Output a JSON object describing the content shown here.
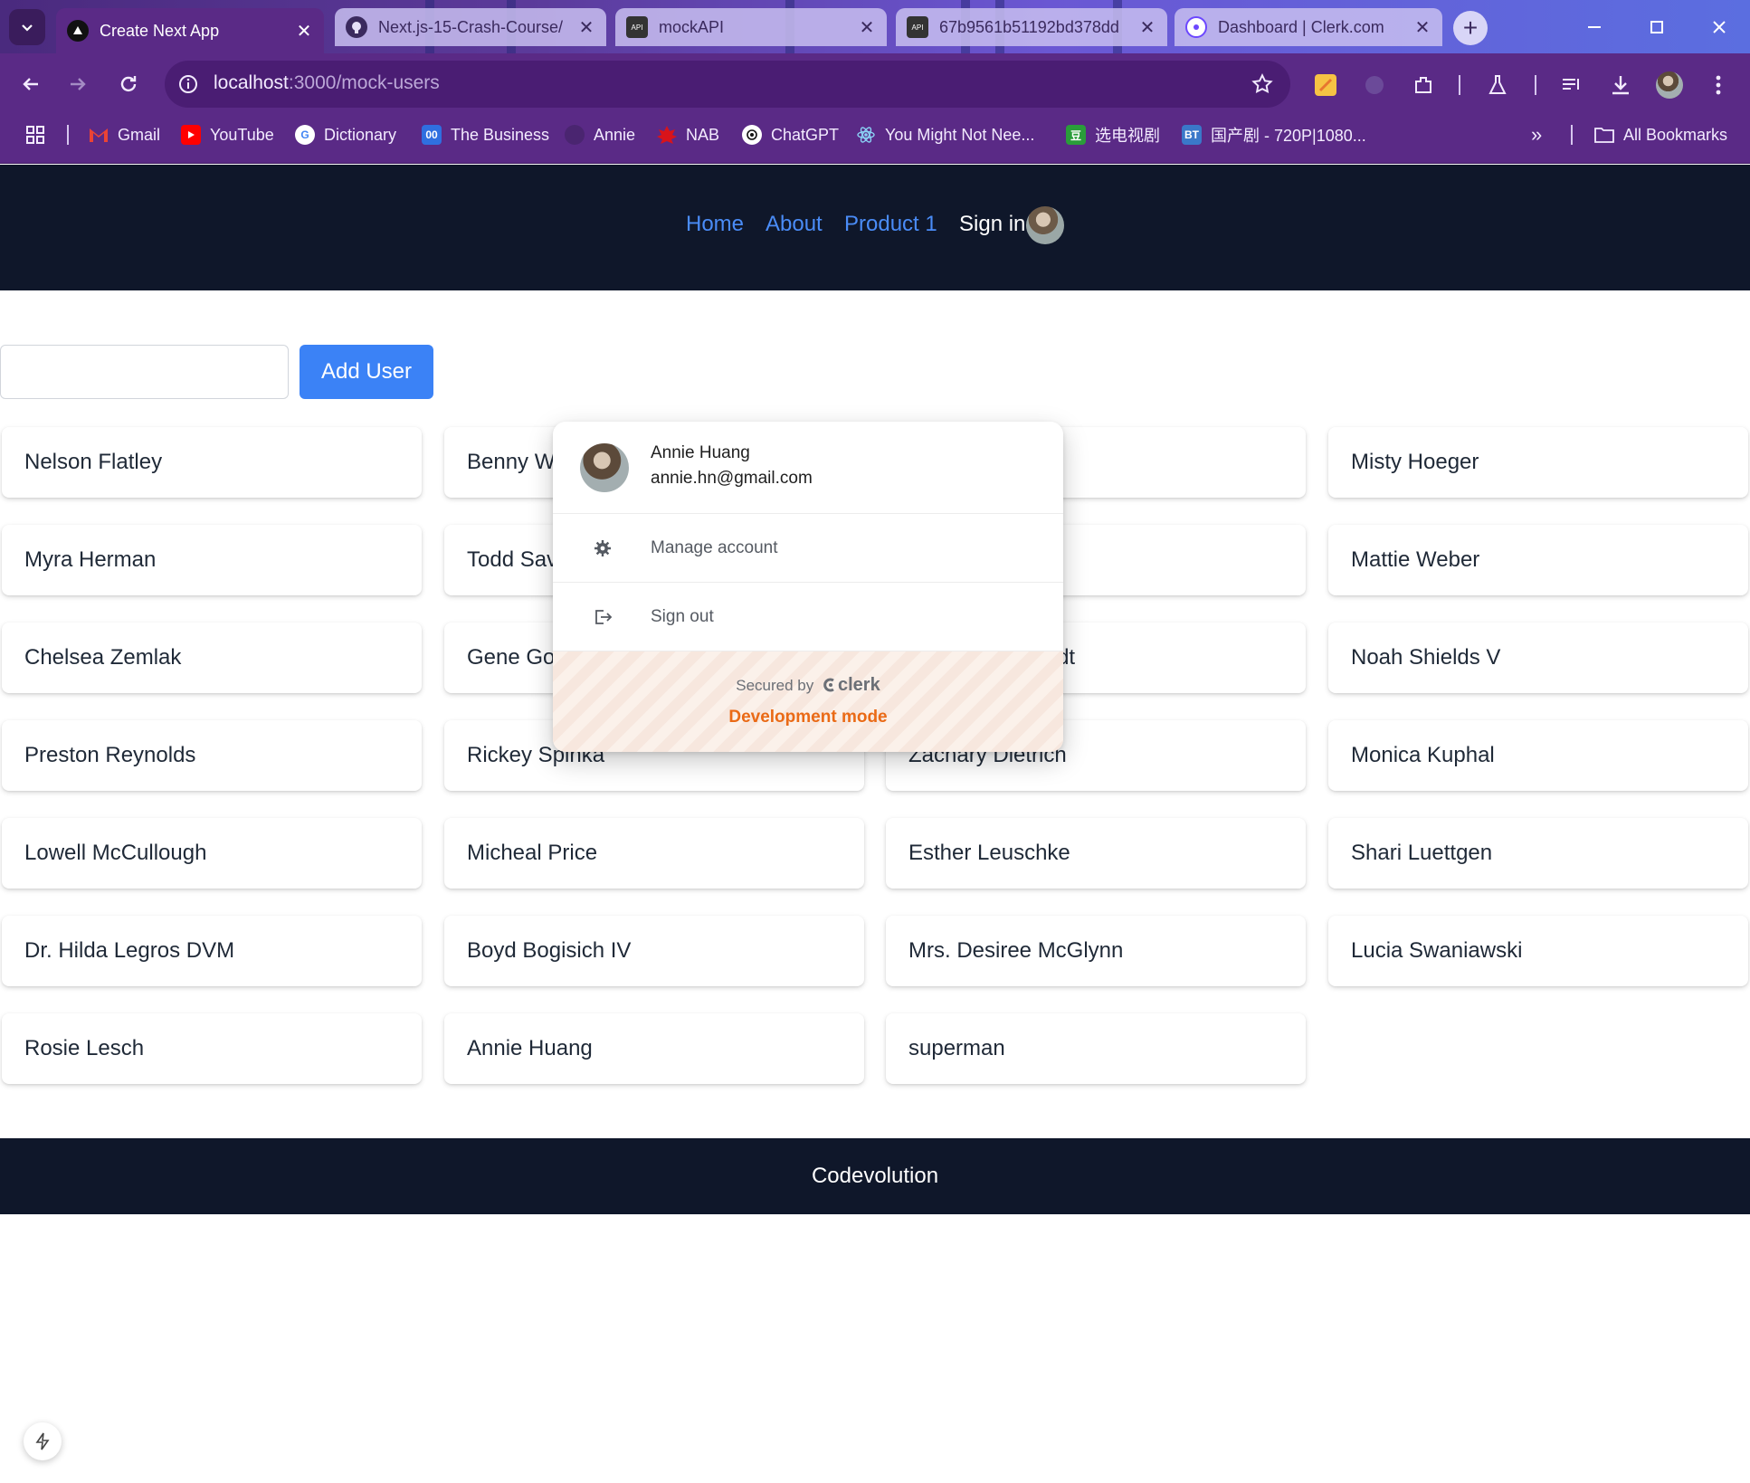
{
  "browser": {
    "tabs": [
      {
        "label": "Create Next App",
        "icon": "nextjs-icon",
        "active": true
      },
      {
        "label": "Next.js-15-Crash-Course/",
        "icon": "github-icon",
        "active": false
      },
      {
        "label": "mockAPI",
        "icon": "mockapi-icon",
        "active": false
      },
      {
        "label": "67b9561b51192bd378dd",
        "icon": "mockapi-icon",
        "active": false
      },
      {
        "label": "Dashboard | Clerk.com",
        "icon": "clerk-icon",
        "active": false
      }
    ],
    "close_glyph": "✕",
    "newtab_glyph": "+",
    "url_host": "localhost",
    "url_path": ":3000/mock-users",
    "bookmarks": [
      {
        "label": "Gmail",
        "icon": "gmail-icon"
      },
      {
        "label": "YouTube",
        "icon": "youtube-icon"
      },
      {
        "label": "Dictionary",
        "icon": "google-icon"
      },
      {
        "label": "The Business",
        "icon": "business-icon"
      },
      {
        "label": "Annie",
        "icon": "github-icon"
      },
      {
        "label": "NAB",
        "icon": "nab-icon"
      },
      {
        "label": "ChatGPT",
        "icon": "chatgpt-icon"
      },
      {
        "label": "You Might Not Nee...",
        "icon": "react-icon"
      },
      {
        "label": "选电视剧",
        "icon": "douban-icon"
      },
      {
        "label": "国产剧 - 720P|1080...",
        "icon": "bt-icon"
      }
    ],
    "bookmarks_overflow": "»",
    "all_bookmarks": "All Bookmarks"
  },
  "site": {
    "nav": {
      "home": "Home",
      "about": "About",
      "product": "Product 1",
      "sign_in": "Sign in"
    },
    "add_user_label": "Add User",
    "add_input_value": "",
    "users": [
      "Nelson Flatley",
      "Benny W",
      "",
      "Misty Hoeger",
      "Myra Herman",
      "Todd Sav",
      "",
      "Mattie Weber",
      "Chelsea Zemlak",
      "Gene Goodwin",
      "Susan Marquardt",
      "Noah Shields V",
      "Preston Reynolds",
      "Rickey Spinka",
      "Zachary Dietrich",
      "Monica Kuphal",
      "Lowell McCullough",
      "Micheal Price",
      "Esther Leuschke",
      "Shari Luettgen",
      "Dr. Hilda Legros DVM",
      "Boyd Bogisich IV",
      "Mrs. Desiree McGlynn",
      "Lucia Swaniawski",
      "Rosie Lesch",
      "Annie Huang",
      "superman"
    ],
    "footer": "Codevolution"
  },
  "popover": {
    "name": "Annie Huang",
    "email": "annie.hn@gmail.com",
    "manage": "Manage account",
    "signout": "Sign out",
    "secured_by": "Secured by",
    "brand": "clerk",
    "dev_mode": "Development mode"
  },
  "colors": {
    "browser_frame": "#5a2a86",
    "site_header": "#0f172a",
    "nav_link": "#4a8cf7",
    "add_button": "#3b82f6",
    "dev_mode": "#ea6a16"
  }
}
